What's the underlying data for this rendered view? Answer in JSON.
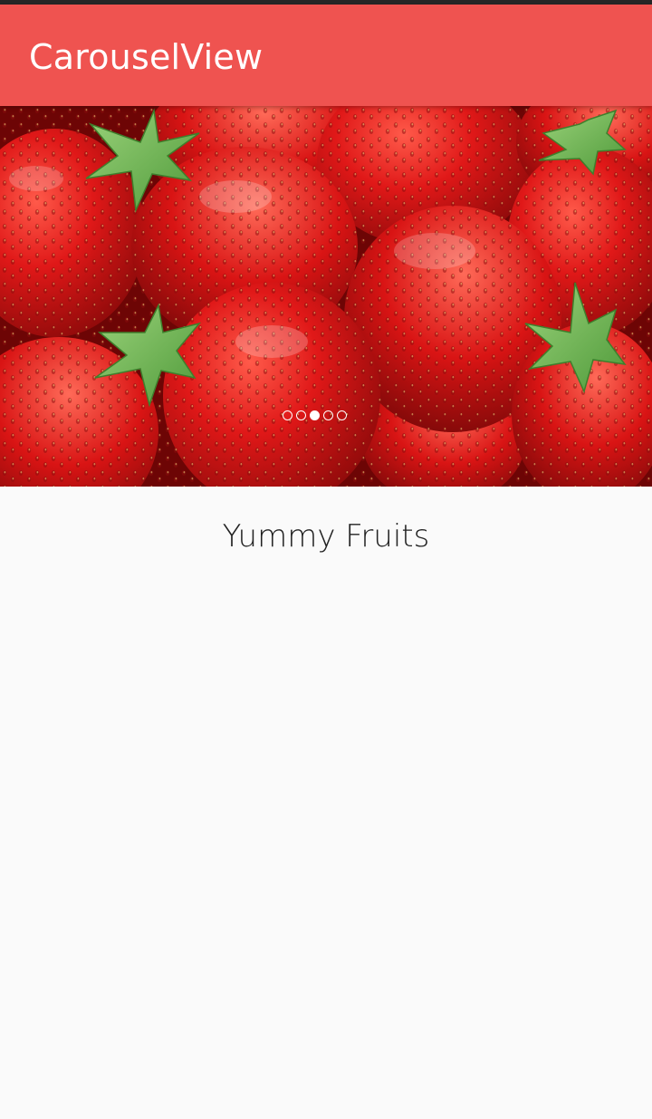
{
  "app_bar": {
    "title": "CarouselView",
    "color": "#ef5350"
  },
  "carousel": {
    "image_subject": "strawberries",
    "page_count": 5,
    "active_index": 2
  },
  "caption": {
    "text": "Yummy Fruits"
  }
}
